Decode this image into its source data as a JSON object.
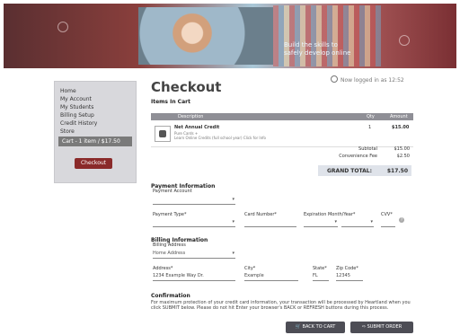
{
  "banner": {
    "tagline_line1": "Build the skills to",
    "tagline_line2": "safely develop online"
  },
  "header": {
    "welcome_text": "Now logged in as 12:52"
  },
  "sidebar": {
    "items": [
      {
        "label": "Home"
      },
      {
        "label": "My Account"
      },
      {
        "label": "My Students"
      },
      {
        "label": "Billing Setup"
      },
      {
        "label": "Credit History"
      },
      {
        "label": "Store"
      },
      {
        "label": "Cart - 1 item / $17.50"
      }
    ],
    "checkout_label": "Checkout"
  },
  "page": {
    "title": "Checkout",
    "items_in_cart_heading": "Items In Cart"
  },
  "cart": {
    "columns": {
      "description": "Description",
      "qty": "Qty",
      "amount": "Amount"
    },
    "items": [
      {
        "name": "Net Annual Credit",
        "desc_line1": "Pure Cards +",
        "desc_line2": "Learn Online Credits (full school year) Click for Info",
        "qty": "1",
        "price": "$15.00"
      }
    ],
    "subtotal_label": "Subtotal",
    "subtotal_value": "$15.00",
    "fee_label": "Convenience Fee",
    "fee_value": "$2.50",
    "grand_label": "GRAND TOTAL:",
    "grand_value": "$17.50"
  },
  "payment": {
    "heading": "Payment Information",
    "account_label": "Payment Account",
    "account_value": "",
    "card_type_label": "Payment Type*",
    "card_number_label": "Card Number*",
    "exp_label": "Expiration Month/Year*",
    "cvv_label": "CVV*"
  },
  "billing": {
    "heading": "Billing Information",
    "saved_label": "Billing Address",
    "saved_value": "Home Address",
    "address_label": "Address*",
    "address_value": "1234 Example Way Dr.",
    "city_label": "City*",
    "city_value": "Example",
    "state_label": "State*",
    "state_value": "FL",
    "zip_label": "Zip Code*",
    "zip_value": "12345"
  },
  "confirmation": {
    "heading": "Confirmation",
    "text": "For maximum protection of your credit card information, your transaction will be processed by Heartland when you click SUBMIT below. Please do not hit Enter your browser's BACK or REFRESH buttons during this process.",
    "back_label": "BACK TO CART",
    "submit_label": "SUBMIT ORDER"
  }
}
